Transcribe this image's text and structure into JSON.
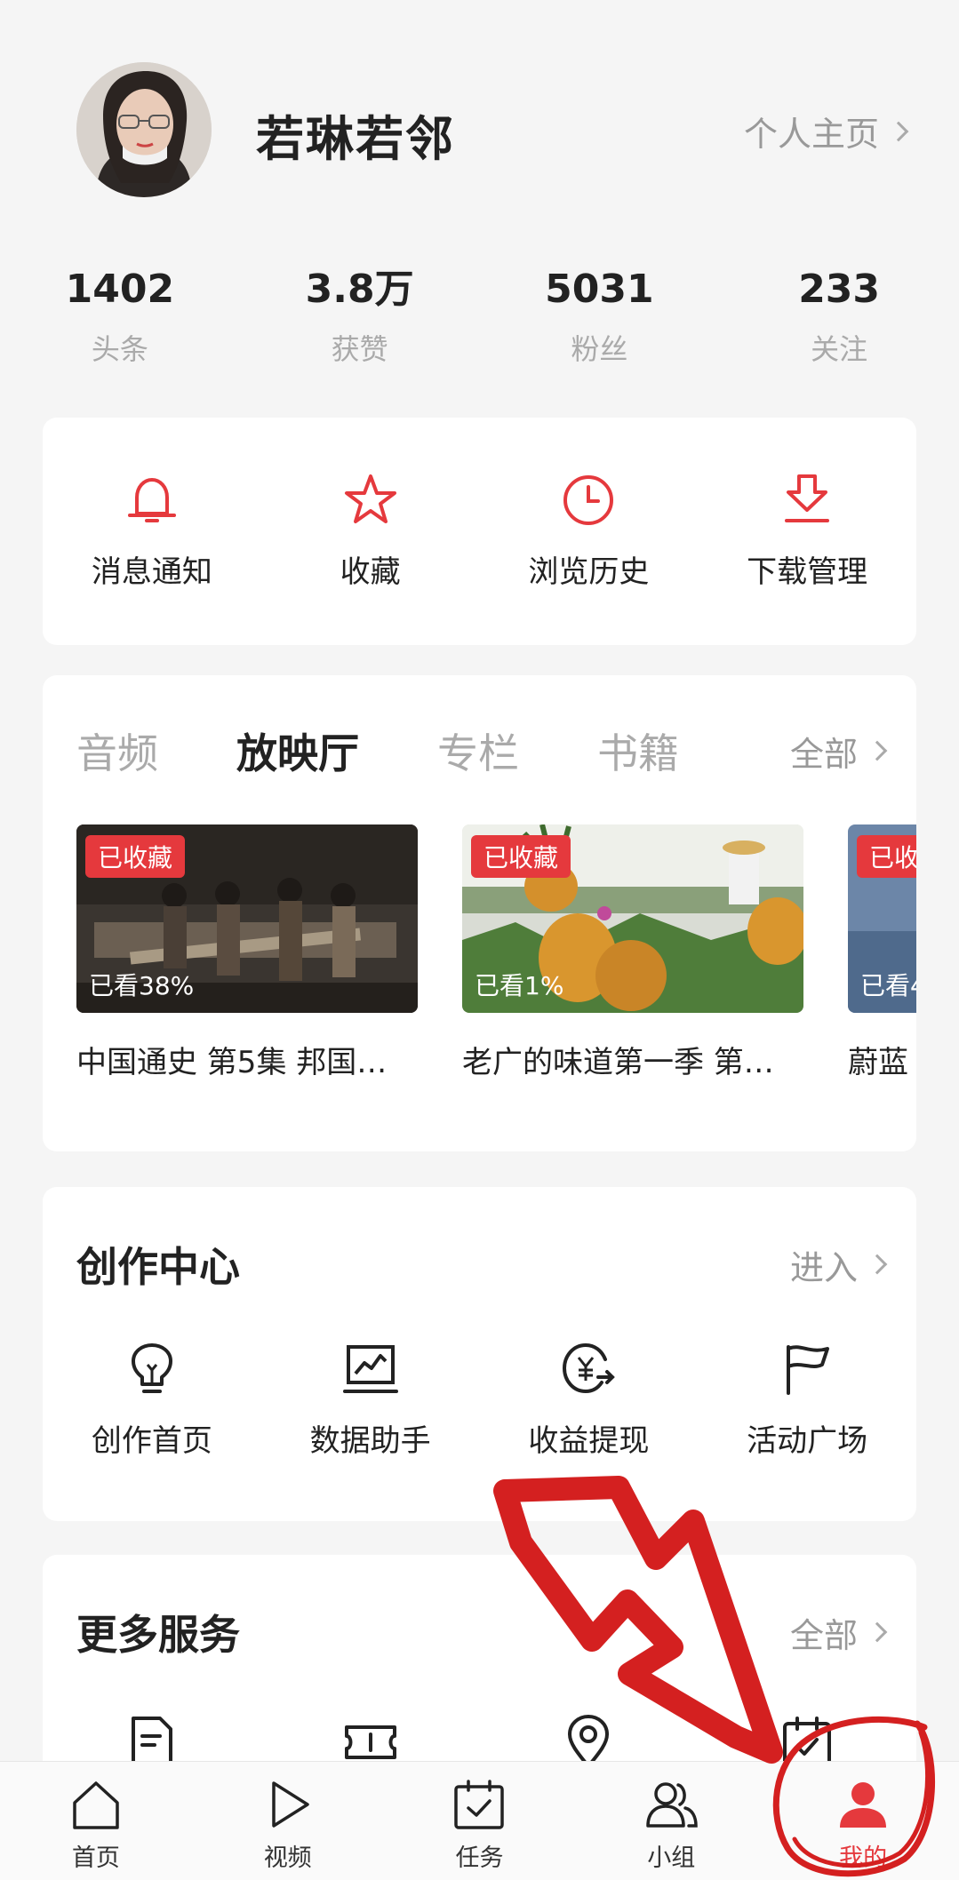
{
  "profile": {
    "username": "若琳若邻",
    "homepage_link": "个人主页"
  },
  "stats": [
    {
      "value": "1402",
      "label": "头条"
    },
    {
      "value": "3.8万",
      "label": "获赞"
    },
    {
      "value": "5031",
      "label": "粉丝"
    },
    {
      "value": "233",
      "label": "关注"
    }
  ],
  "quick_actions": [
    {
      "label": "消息通知",
      "icon": "bell-icon"
    },
    {
      "label": "收藏",
      "icon": "star-icon"
    },
    {
      "label": "浏览历史",
      "icon": "clock-icon"
    },
    {
      "label": "下载管理",
      "icon": "download-icon"
    }
  ],
  "media": {
    "tabs": [
      "音频",
      "放映厅",
      "专栏",
      "书籍"
    ],
    "active_tab": "放映厅",
    "all_label": "全部",
    "items": [
      {
        "badge": "已收藏",
        "progress": "已看38%",
        "title": "中国通史 第5集 邦国…"
      },
      {
        "badge": "已收藏",
        "progress": "已看1%",
        "title": "老广的味道第一季 第…"
      },
      {
        "badge": "已收",
        "progress": "已看4",
        "title": "蔚蓝"
      }
    ]
  },
  "creation_center": {
    "title": "创作中心",
    "link": "进入",
    "items": [
      {
        "label": "创作首页",
        "icon": "lightbulb-icon"
      },
      {
        "label": "数据助手",
        "icon": "chart-icon"
      },
      {
        "label": "收益提现",
        "icon": "yuan-coin-icon"
      },
      {
        "label": "活动广场",
        "icon": "flag-icon"
      }
    ]
  },
  "more_services": {
    "title": "更多服务",
    "link": "全部",
    "icons": [
      "document-icon",
      "ticket-icon",
      "location-icon",
      "calendar-check-icon"
    ]
  },
  "tabbar": [
    {
      "label": "首页",
      "icon": "home-icon"
    },
    {
      "label": "视频",
      "icon": "play-icon"
    },
    {
      "label": "任务",
      "icon": "task-icon"
    },
    {
      "label": "小组",
      "icon": "group-icon"
    },
    {
      "label": "我的",
      "icon": "person-icon",
      "active": true
    }
  ],
  "colors": {
    "accent": "#e5393d",
    "text": "#222222",
    "muted": "#aaaaaa",
    "background": "#f5f5f5"
  }
}
